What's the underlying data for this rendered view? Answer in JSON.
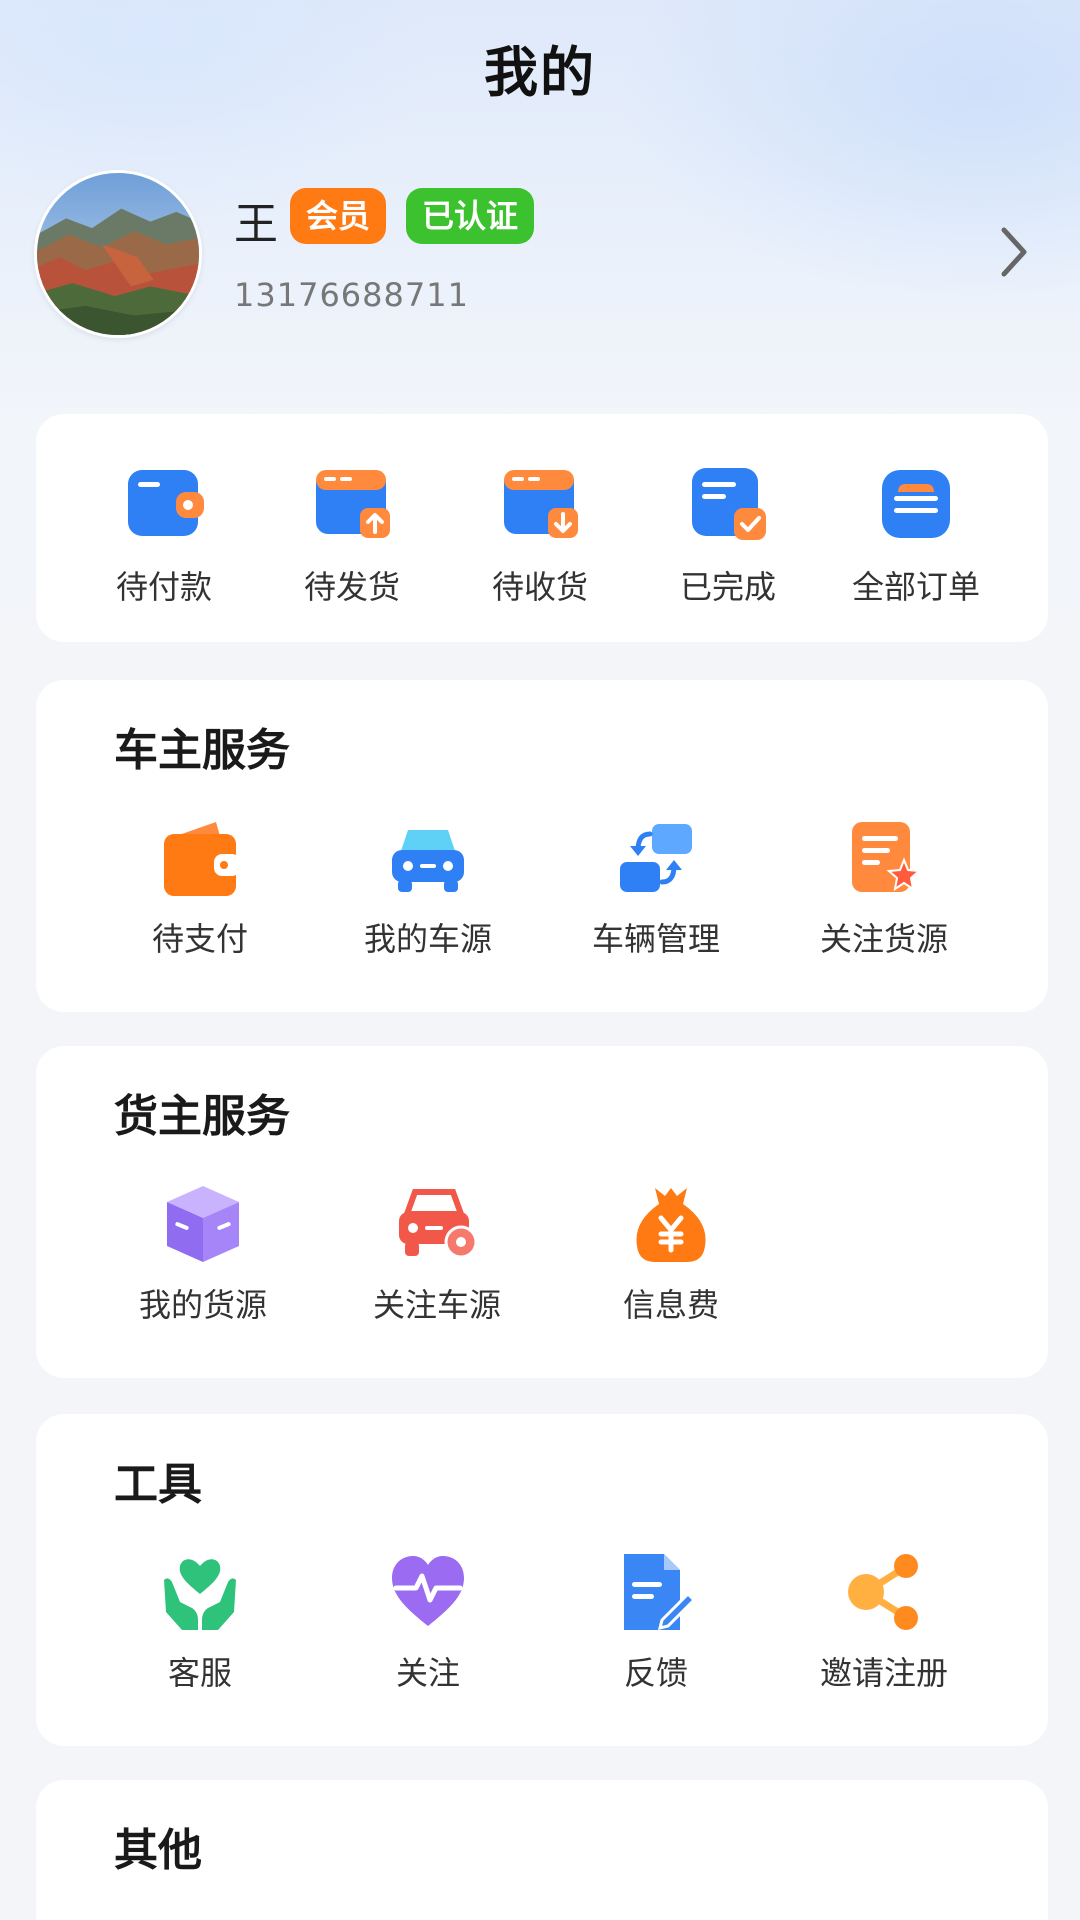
{
  "header": {
    "title": "我的"
  },
  "profile": {
    "name": "王",
    "badges": {
      "member": "会员",
      "verified": "已认证"
    },
    "phone": "13176688711"
  },
  "orders": {
    "items": [
      {
        "label": "待付款",
        "icon": "wallet-icon"
      },
      {
        "label": "待发货",
        "icon": "ship-out-icon"
      },
      {
        "label": "待收货",
        "icon": "receive-icon"
      },
      {
        "label": "已完成",
        "icon": "completed-icon"
      },
      {
        "label": "全部订单",
        "icon": "all-orders-icon"
      }
    ]
  },
  "owner_services": {
    "title": "车主服务",
    "items": [
      {
        "label": "待支付",
        "icon": "purse-icon"
      },
      {
        "label": "我的车源",
        "icon": "car-icon"
      },
      {
        "label": "车辆管理",
        "icon": "swap-icon"
      },
      {
        "label": "关注货源",
        "icon": "doc-star-icon"
      }
    ]
  },
  "shipper_services": {
    "title": "货主服务",
    "items": [
      {
        "label": "我的货源",
        "icon": "box-icon"
      },
      {
        "label": "关注车源",
        "icon": "car-gear-icon"
      },
      {
        "label": "信息费",
        "icon": "money-bag-icon"
      }
    ]
  },
  "tools": {
    "title": "工具",
    "items": [
      {
        "label": "客服",
        "icon": "care-icon"
      },
      {
        "label": "关注",
        "icon": "heart-pulse-icon"
      },
      {
        "label": "反馈",
        "icon": "feedback-icon"
      },
      {
        "label": "邀请注册",
        "icon": "share-icon"
      }
    ]
  },
  "other": {
    "title": "其他"
  },
  "colors": {
    "blue": "#2f7ff5",
    "orange": "#ff7a12",
    "green": "#3cc22e",
    "purple": "#9b7bf2"
  }
}
